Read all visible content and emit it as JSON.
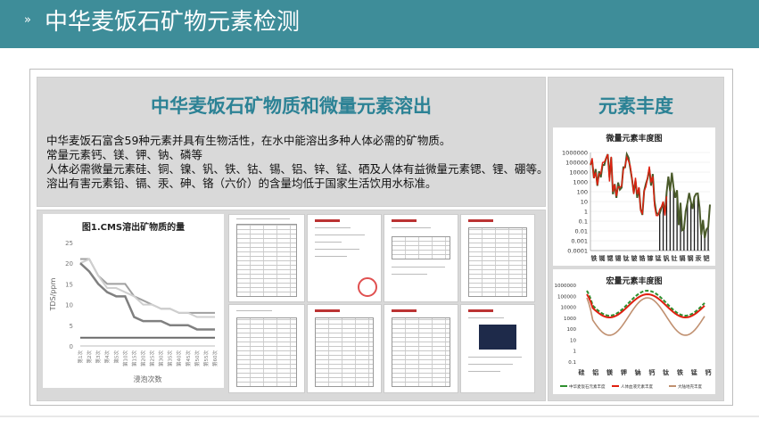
{
  "header": {
    "title": "中华麦饭石矿物元素检测"
  },
  "left_panel": {
    "heading": "中华麦饭石矿物质和微量元素溶出",
    "lines": [
      "中华麦饭石富含59种元素并具有生物活性，在水中能溶出多种人体必需的矿物质。",
      "常量元素钙、镁、钾、钠、磷等",
      "人体必需微量元素硅、铜、镍、钒、铁、钴、锡、铝、锌、锰、硒及人体有益微量元素锶、锂、硼等。",
      "溶出有害元素铅、镉、汞、砷、铬（六价）的含量均低于国家生活饮用水标准。"
    ]
  },
  "right_panel": {
    "heading": "元素丰度",
    "micro_chart_title": "微量元素丰度图",
    "macro_chart_title": "宏量元素丰度图"
  },
  "colors": {
    "header_bg": "#3e8d99",
    "heading_text": "#2c8295",
    "panel_bg": "#d9d9d9"
  },
  "chart_data": [
    {
      "type": "line",
      "title": "图1.CMS溶出矿物质的量",
      "xlabel": "浸泡次数",
      "ylabel": "TDS/ppm",
      "ylim": [
        0,
        25
      ],
      "yticks": [
        0,
        5,
        10,
        15,
        20,
        25
      ],
      "categories": [
        "第1次",
        "第2次",
        "第3次",
        "第4次",
        "第5次",
        "第10次",
        "第15次",
        "第20次",
        "第25次",
        "第30次",
        "第35次",
        "第40次",
        "第45次",
        "第50次",
        "第55次",
        "第60次"
      ],
      "series": [
        {
          "values": [
            21,
            21,
            17,
            15,
            15,
            15,
            12,
            11,
            10,
            9,
            9,
            8,
            8,
            8,
            8,
            8
          ],
          "color": "#a0a0a0",
          "width": 2
        },
        {
          "values": [
            20,
            21,
            17,
            14,
            14,
            13,
            12,
            10,
            10,
            9,
            9,
            8,
            8,
            7,
            7,
            7
          ],
          "color": "#cfcfcf",
          "width": 2
        },
        {
          "values": [
            20,
            18,
            15,
            13,
            12,
            12,
            7,
            6,
            6,
            6,
            5,
            5,
            5,
            4,
            4,
            4
          ],
          "color": "#808080",
          "width": 2.5
        },
        {
          "values": [
            2,
            2,
            2,
            2,
            2,
            2,
            2,
            2,
            2,
            2,
            2,
            2,
            2,
            2,
            2,
            2
          ],
          "color": "#6a6a6a",
          "width": 2
        }
      ]
    },
    {
      "type": "line",
      "title": "微量元素丰度图",
      "yscale": "log",
      "yticks": [
        "1000000",
        "100000",
        "10000",
        "1000",
        "100",
        "10",
        "1",
        "0.1",
        "0.01",
        "0.001",
        "0.0001"
      ],
      "xticks": [
        "铁",
        "铷",
        "锶",
        "锡",
        "钛",
        "铍",
        "锆",
        "镓",
        "锰",
        "钒",
        "钍",
        "镉",
        "钢",
        "汞",
        "钯"
      ]
    },
    {
      "type": "line",
      "title": "宏量元素丰度图",
      "yscale": "log",
      "yticks": [
        "1000000",
        "100000",
        "10000",
        "1000",
        "100",
        "10",
        "1",
        "0.1"
      ],
      "xticks": [
        "硅",
        "铝",
        "镁",
        "钾",
        "钠",
        "钙",
        "钛",
        "铁",
        "锰",
        "钙"
      ],
      "legend": [
        "中华麦饭石元素丰度",
        "人体血液元素丰度",
        "大陆地壳丰度"
      ]
    }
  ]
}
